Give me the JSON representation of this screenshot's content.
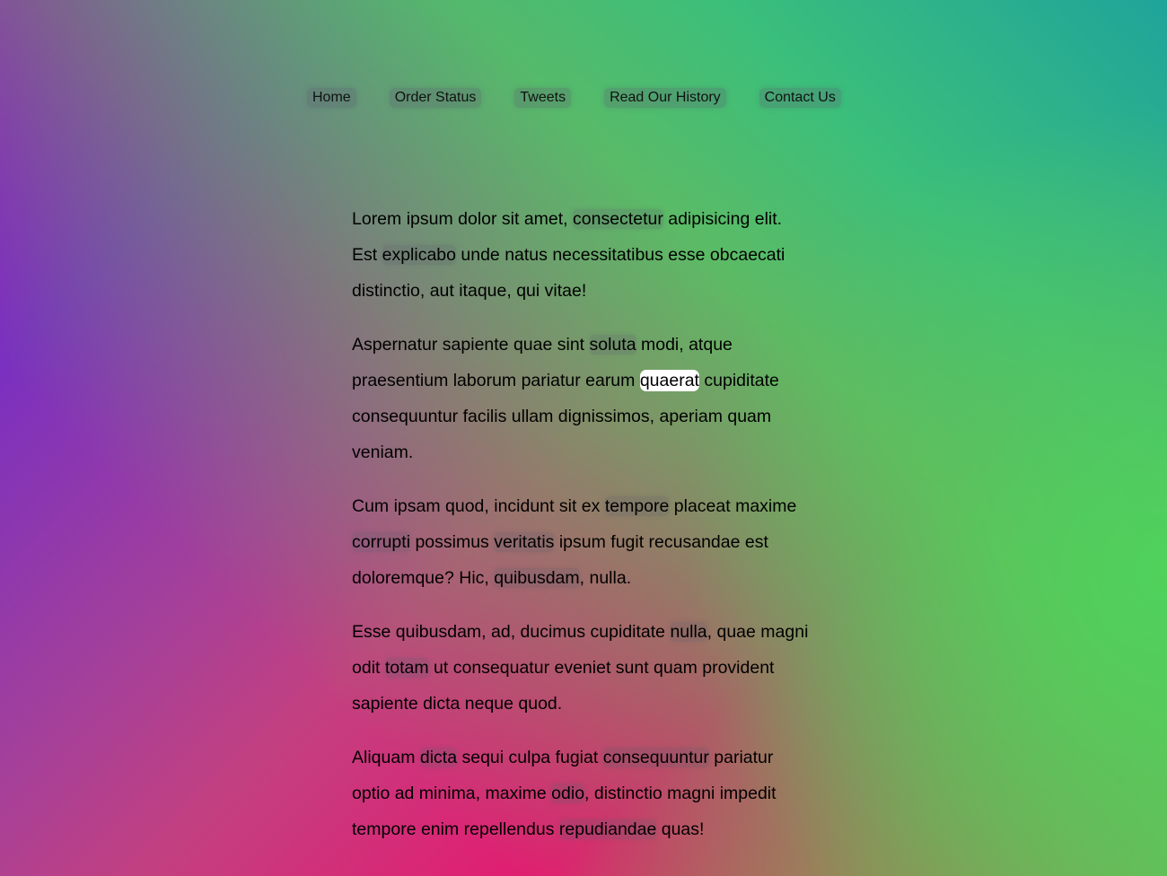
{
  "nav": {
    "items": [
      {
        "label": "Home"
      },
      {
        "label": "Order Status"
      },
      {
        "label": "Tweets"
      },
      {
        "label": "Read Our History"
      },
      {
        "label": "Contact Us"
      }
    ]
  },
  "content": {
    "p1": {
      "t1": "Lorem ipsum dolor sit amet, ",
      "w1": "consectetur",
      "t2": " adipisicing elit. Est ",
      "w2": "explicabo",
      "t3": " unde natus necessitatibus esse obcaecati distinctio, aut itaque, qui vitae!"
    },
    "p2": {
      "t1": "Aspernatur sapiente quae sint ",
      "w1": "soluta",
      "t2": " modi, atque praesentium laborum pariatur earum ",
      "w2": "quaerat",
      "t3": " cupiditate consequuntur facilis ullam dignissimos, aperiam quam veniam."
    },
    "p3": {
      "t1": "Cum ipsam quod, incidunt sit ex ",
      "w1": "tempore",
      "t2": " placeat maxime ",
      "w2": "corrupti",
      "t3": " possimus ",
      "w3": "veritatis",
      "t4": " ipsum fugit recusandae est doloremque? Hic, ",
      "w4": "quibusdam",
      "t5": ", nulla."
    },
    "p4": {
      "t1": "Esse quibusdam, ad, ducimus cupiditate ",
      "w1": "nulla",
      "t2": ", quae magni odit ",
      "w2": "totam",
      "t3": " ut consequatur eveniet sunt quam provident sapiente dicta neque quod."
    },
    "p5": {
      "t1": "Aliquam ",
      "w1": "dicta",
      "t2": " sequi culpa fugiat ",
      "w2": "consequuntur",
      "t3": " pariatur optio ad minima, maxime ",
      "w3": "odio",
      "t4": ", distinctio magni impedit tempore enim repellendus ",
      "w4": "repudiandae",
      "t5": " quas!"
    }
  }
}
